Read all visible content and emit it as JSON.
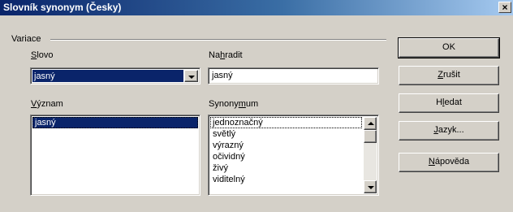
{
  "window": {
    "title": "Slovník synonym (Česky)",
    "close_glyph": "×"
  },
  "group": {
    "label": "Variace"
  },
  "word": {
    "label_first": "S",
    "label_rest": "lovo",
    "value": "jasný"
  },
  "replace": {
    "label_pre": "Na",
    "label_u": "h",
    "label_post": "radit",
    "value": "jasný"
  },
  "meaning": {
    "label_first": "V",
    "label_rest": "ýznam",
    "items": [
      "jasný"
    ]
  },
  "synonyms": {
    "label_pre": "Synony",
    "label_u": "m",
    "label_post": "um",
    "items": [
      "jednoznačný",
      "světlý",
      "výrazný",
      "očividný",
      "živý",
      "viditelný"
    ]
  },
  "buttons": {
    "ok": "OK",
    "cancel_u": "Z",
    "cancel_rest": "rušit",
    "search_pre": "H",
    "search_u": "l",
    "search_post": "edat",
    "language_u": "J",
    "language_rest": "azyk...",
    "help_u": "N",
    "help_rest": "ápověda"
  },
  "colors": {
    "dialog_bg": "#d4d0c8",
    "title_start": "#0a246a",
    "title_end": "#a6caf0",
    "selection": "#0a246a"
  }
}
